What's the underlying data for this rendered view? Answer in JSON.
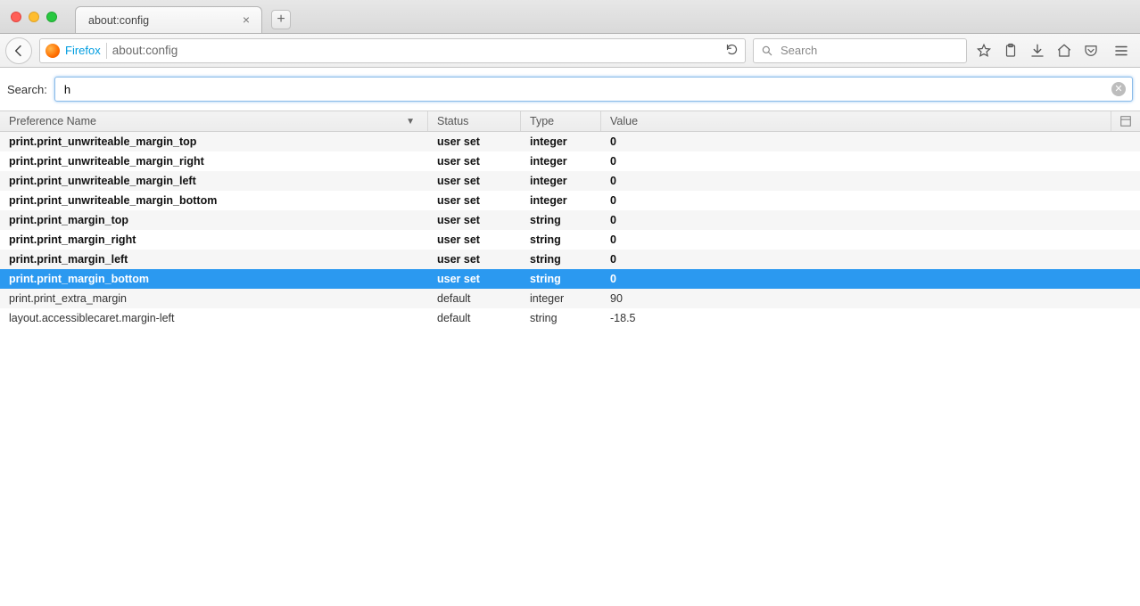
{
  "window": {
    "tab_title": "about:config",
    "url_identity": "Firefox",
    "url_text": "about:config",
    "search_placeholder": "Search"
  },
  "config": {
    "search_label": "Search:",
    "search_value": "h",
    "columns": {
      "pref": "Preference Name",
      "status": "Status",
      "type": "Type",
      "value": "Value"
    },
    "rows": [
      {
        "name": "print.print_unwriteable_margin_top",
        "status": "user set",
        "type": "integer",
        "value": "0",
        "user": true,
        "selected": false
      },
      {
        "name": "print.print_unwriteable_margin_right",
        "status": "user set",
        "type": "integer",
        "value": "0",
        "user": true,
        "selected": false
      },
      {
        "name": "print.print_unwriteable_margin_left",
        "status": "user set",
        "type": "integer",
        "value": "0",
        "user": true,
        "selected": false
      },
      {
        "name": "print.print_unwriteable_margin_bottom",
        "status": "user set",
        "type": "integer",
        "value": "0",
        "user": true,
        "selected": false
      },
      {
        "name": "print.print_margin_top",
        "status": "user set",
        "type": "string",
        "value": "0",
        "user": true,
        "selected": false
      },
      {
        "name": "print.print_margin_right",
        "status": "user set",
        "type": "string",
        "value": "0",
        "user": true,
        "selected": false
      },
      {
        "name": "print.print_margin_left",
        "status": "user set",
        "type": "string",
        "value": "0",
        "user": true,
        "selected": false
      },
      {
        "name": "print.print_margin_bottom",
        "status": "user set",
        "type": "string",
        "value": "0",
        "user": true,
        "selected": true
      },
      {
        "name": "print.print_extra_margin",
        "status": "default",
        "type": "integer",
        "value": "90",
        "user": false,
        "selected": false
      },
      {
        "name": "layout.accessiblecaret.margin-left",
        "status": "default",
        "type": "string",
        "value": "-18.5",
        "user": false,
        "selected": false
      }
    ]
  }
}
